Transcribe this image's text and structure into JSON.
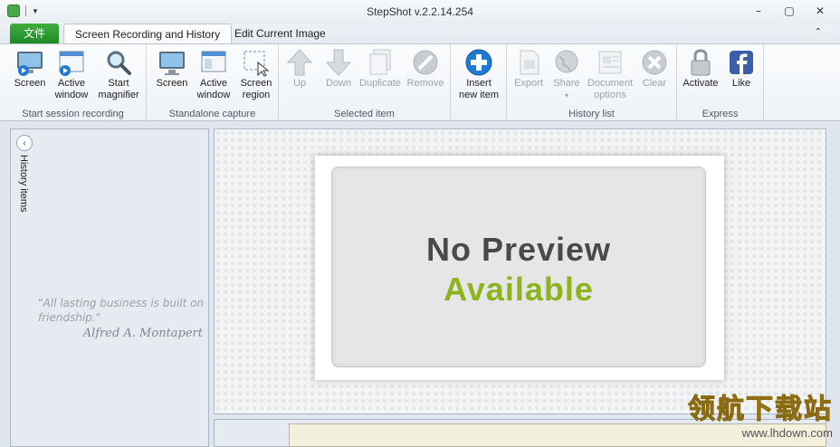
{
  "window": {
    "title": "StepShot v.2.2.14.254",
    "minimize_glyph": "–",
    "restore_glyph": "▢",
    "close_glyph": "✕"
  },
  "tabs": {
    "file": "文件",
    "items": [
      "Screen Recording and History",
      "Edit Current Image"
    ],
    "active": "Screen Recording and History"
  },
  "ribbon": {
    "groups": [
      {
        "label": "Start session recording",
        "buttons": [
          {
            "label": "Screen",
            "icon": "monitor-record-icon",
            "enabled": true
          },
          {
            "label": "Active window",
            "icon": "window-record-icon",
            "enabled": true
          },
          {
            "label": "Start magnifier",
            "icon": "magnifier-icon",
            "enabled": true
          }
        ]
      },
      {
        "label": "Standalone capture",
        "buttons": [
          {
            "label": "Screen",
            "icon": "monitor-icon",
            "enabled": true
          },
          {
            "label": "Active window",
            "icon": "window-icon",
            "enabled": true
          },
          {
            "label": "Screen region",
            "icon": "region-select-icon",
            "enabled": true
          }
        ]
      },
      {
        "label": "Selected item",
        "buttons": [
          {
            "label": "Up",
            "icon": "arrow-up-icon",
            "enabled": false
          },
          {
            "label": "Down",
            "icon": "arrow-down-icon",
            "enabled": false
          },
          {
            "label": "Duplicate",
            "icon": "duplicate-icon",
            "enabled": false
          },
          {
            "label": "Remove",
            "icon": "remove-icon",
            "enabled": false
          }
        ]
      },
      {
        "label": "",
        "buttons": [
          {
            "label": "Insert new item",
            "icon": "plus-circle-icon",
            "enabled": true
          }
        ]
      },
      {
        "label": "History list",
        "buttons": [
          {
            "label": "Export",
            "icon": "export-icon",
            "enabled": false
          },
          {
            "label": "Share",
            "icon": "globe-share-icon",
            "enabled": false
          },
          {
            "label": "Document options",
            "icon": "document-options-icon",
            "enabled": false
          },
          {
            "label": "Clear",
            "icon": "clear-icon",
            "enabled": false
          }
        ]
      },
      {
        "label": "Express",
        "buttons": [
          {
            "label": "Activate",
            "icon": "lock-icon",
            "enabled": true
          },
          {
            "label": "Like",
            "icon": "facebook-icon",
            "enabled": true
          }
        ]
      }
    ]
  },
  "history_panel": {
    "label": "History items",
    "collapse_glyph": "‹",
    "quote": "\"All lasting business is built on friendship.\"",
    "author": "Alfred A. Montapert"
  },
  "preview": {
    "line1": "No Preview",
    "line2": "Available"
  },
  "colors": {
    "file_tab": "#2a9a30",
    "available_text": "#8db31f",
    "accent_blue": "#1f7ad6"
  },
  "watermark": {
    "cn": "领航下载站",
    "url": "www.lhdown.com"
  }
}
